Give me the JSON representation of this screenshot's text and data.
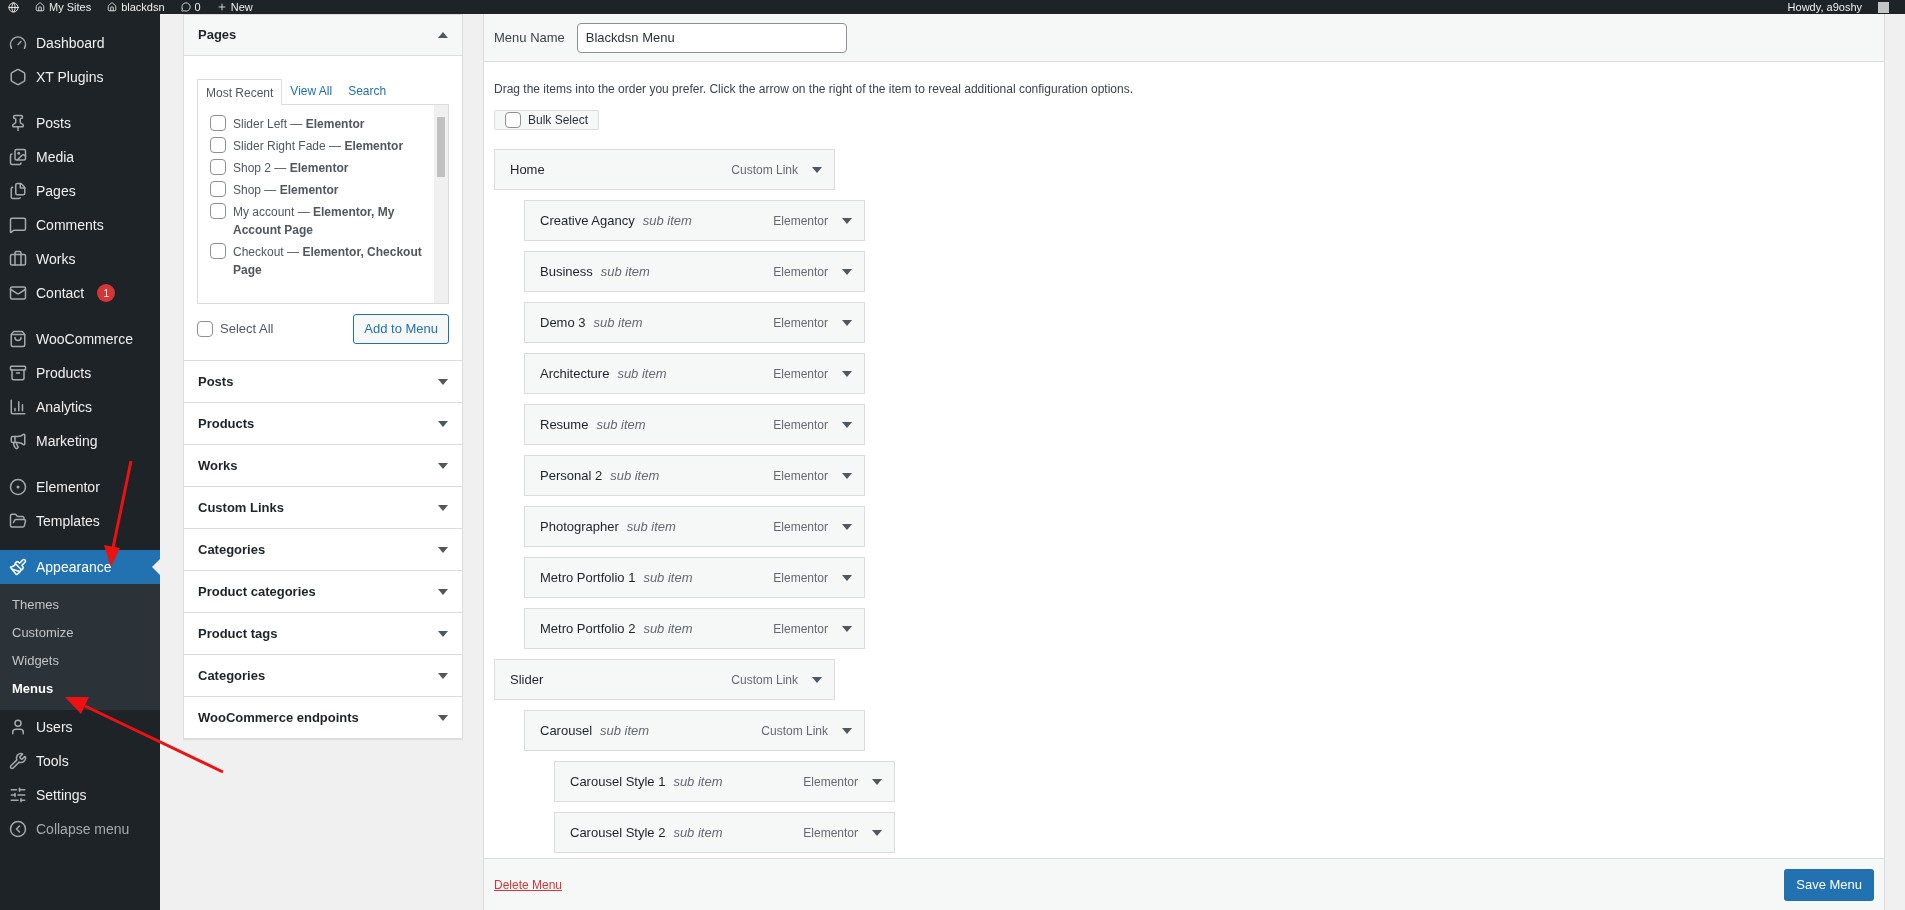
{
  "admin_bar": {
    "items": [
      "My Sites",
      "blackdsn",
      "0",
      "New"
    ],
    "greeting": "Howdy, a9oshy"
  },
  "sidebar": {
    "groups": [
      [
        {
          "label": "Dashboard",
          "selected": false
        },
        {
          "label": "XT Plugins",
          "selected": false
        }
      ],
      [
        {
          "label": "Posts",
          "selected": false
        },
        {
          "label": "Media",
          "selected": false
        },
        {
          "label": "Pages",
          "selected": false
        },
        {
          "label": "Comments",
          "selected": false
        },
        {
          "label": "Works",
          "selected": false
        },
        {
          "label": "Contact",
          "selected": false,
          "badge": "1"
        }
      ],
      [
        {
          "label": "WooCommerce",
          "selected": false
        },
        {
          "label": "Products",
          "selected": false
        },
        {
          "label": "Analytics",
          "selected": false
        },
        {
          "label": "Marketing",
          "selected": false
        }
      ],
      [
        {
          "label": "Elementor",
          "selected": false
        },
        {
          "label": "Templates",
          "selected": false
        }
      ],
      [
        {
          "label": "Appearance",
          "selected": true,
          "children": [
            {
              "label": "Themes",
              "selected": false
            },
            {
              "label": "Customize",
              "selected": false
            },
            {
              "label": "Widgets",
              "selected": false
            },
            {
              "label": "Menus",
              "selected": true
            }
          ]
        },
        {
          "label": "Users",
          "selected": false
        },
        {
          "label": "Tools",
          "selected": false
        },
        {
          "label": "Settings",
          "selected": false
        }
      ]
    ],
    "collapse_label": "Collapse menu"
  },
  "add_items": {
    "sections": [
      {
        "title": "Pages",
        "expanded": true,
        "tabs": [
          {
            "label": "Most Recent",
            "selected": true
          },
          {
            "label": "View All",
            "selected": false
          },
          {
            "label": "Search",
            "selected": false
          }
        ],
        "items": [
          {
            "label": "Slider Left — **Elementor**",
            "checked": false
          },
          {
            "label": "Slider Right Fade — **Elementor**",
            "checked": false
          },
          {
            "label": "Shop 2 — **Elementor**",
            "checked": false
          },
          {
            "label": "Shop — **Elementor**",
            "checked": false
          },
          {
            "label": "My account — **Elementor, My Account Page**",
            "checked": false
          },
          {
            "label": "Checkout — **Elementor, Checkout Page**",
            "checked": false
          }
        ],
        "select_all": {
          "label": "Select All",
          "checked": false
        },
        "add_button": "Add to Menu"
      },
      {
        "title": "Posts",
        "expanded": false
      },
      {
        "title": "Products",
        "expanded": false
      },
      {
        "title": "Works",
        "expanded": false
      },
      {
        "title": "Custom Links",
        "expanded": false
      },
      {
        "title": "Categories",
        "expanded": false
      },
      {
        "title": "Product categories",
        "expanded": false
      },
      {
        "title": "Product tags",
        "expanded": false
      },
      {
        "title": "Categories",
        "expanded": false
      },
      {
        "title": "WooCommerce endpoints",
        "expanded": false
      }
    ]
  },
  "menu_editor": {
    "name_label": "Menu Name",
    "name_value": "Blackdsn Menu",
    "instructions": "Drag the items into the order you prefer. Click the arrow on the right of the item to reveal additional configuration options.",
    "bulk_select": {
      "label": "Bulk Select",
      "checked": false
    },
    "items": [
      {
        "title": "Home",
        "type": "Custom Link",
        "children": [
          {
            "title": "Creative Agancy",
            "note": "sub item",
            "type": "Elementor"
          },
          {
            "title": "Business",
            "note": "sub item",
            "type": "Elementor"
          },
          {
            "title": "Demo 3",
            "note": "sub item",
            "type": "Elementor"
          },
          {
            "title": "Architecture",
            "note": "sub item",
            "type": "Elementor"
          },
          {
            "title": "Resume",
            "note": "sub item",
            "type": "Elementor"
          },
          {
            "title": "Personal 2",
            "note": "sub item",
            "type": "Elementor"
          },
          {
            "title": "Photographer",
            "note": "sub item",
            "type": "Elementor"
          },
          {
            "title": "Metro Portfolio 1",
            "note": "sub item",
            "type": "Elementor"
          },
          {
            "title": "Metro Portfolio 2",
            "note": "sub item",
            "type": "Elementor"
          }
        ]
      },
      {
        "title": "Slider",
        "type": "Custom Link",
        "children": [
          {
            "title": "Carousel",
            "note": "sub item",
            "type": "Custom Link",
            "children": [
              {
                "title": "Carousel Style 1",
                "note": "sub item",
                "type": "Elementor"
              },
              {
                "title": "Carousel Style 2",
                "note": "sub item",
                "type": "Elementor"
              }
            ]
          }
        ]
      }
    ],
    "delete_link": "Delete Menu",
    "save_button": "Save Menu"
  }
}
